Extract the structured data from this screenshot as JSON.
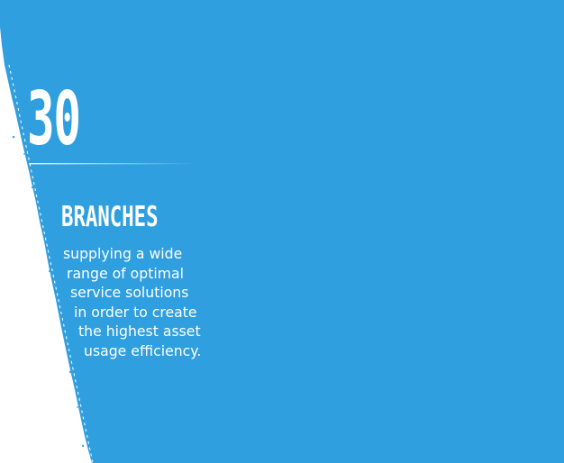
{
  "stat": {
    "number": "30",
    "label": "BRANCHES"
  },
  "description": {
    "lines": [
      "supplying a wide",
      "range of optimal",
      "service solutions",
      "in order to create",
      "the highest asset",
      "usage efficiency."
    ]
  },
  "colors": {
    "background": "#2f9fdf",
    "accent_light": "#ffffff"
  }
}
